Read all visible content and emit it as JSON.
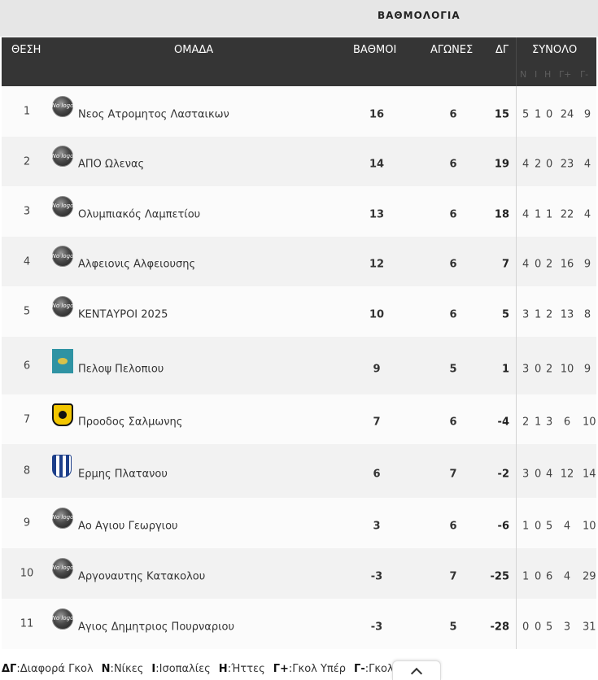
{
  "title": "ΒΑΘΜΟΛΟΓΙΑ",
  "headers": {
    "pos": "ΘΕΣΗ",
    "team": "ΟΜΑΔΑ",
    "points": "ΒΑΘΜΟΙ",
    "played": "ΑΓΩΝΕΣ",
    "gd": "ΔΓ",
    "total": "ΣΥΝΟΛΟ",
    "sub": [
      "Ν",
      "Ι",
      "Η",
      "Γ+",
      "Γ-"
    ]
  },
  "rows": [
    {
      "pos": "1",
      "team": "Νεος Ατρομητος Λασταικων",
      "logo": "no-logo-icon",
      "points": "16",
      "played": "6",
      "gd": "15",
      "w": "5",
      "d": "1",
      "l": "0",
      "gf": "24",
      "ga": "9"
    },
    {
      "pos": "2",
      "team": "ΑΠΟ Ωλενας",
      "logo": "no-logo-icon",
      "points": "14",
      "played": "6",
      "gd": "19",
      "w": "4",
      "d": "2",
      "l": "0",
      "gf": "23",
      "ga": "4"
    },
    {
      "pos": "3",
      "team": "Ολυμπιακός Λαμπετίου",
      "logo": "no-logo-icon",
      "points": "13",
      "played": "6",
      "gd": "18",
      "w": "4",
      "d": "1",
      "l": "1",
      "gf": "22",
      "ga": "4"
    },
    {
      "pos": "4",
      "team": "Αλφειονις Αλφειουσης",
      "logo": "no-logo-icon",
      "points": "12",
      "played": "6",
      "gd": "7",
      "w": "4",
      "d": "0",
      "l": "2",
      "gf": "16",
      "ga": "9"
    },
    {
      "pos": "5",
      "team": "ΚΕΝΤΑΥΡΟΙ 2025",
      "logo": "no-logo-icon",
      "points": "10",
      "played": "6",
      "gd": "5",
      "w": "3",
      "d": "1",
      "l": "2",
      "gf": "13",
      "ga": "8"
    },
    {
      "pos": "6",
      "team": "Πελοψ Πελοπιου",
      "logo": "club-crest-teal-icon",
      "points": "9",
      "played": "5",
      "gd": "1",
      "w": "3",
      "d": "0",
      "l": "2",
      "gf": "10",
      "ga": "9"
    },
    {
      "pos": "7",
      "team": "Προοδος Σαλμωνης",
      "logo": "club-crest-yellow-icon",
      "points": "7",
      "played": "6",
      "gd": "-4",
      "w": "2",
      "d": "1",
      "l": "3",
      "gf": "6",
      "ga": "10"
    },
    {
      "pos": "8",
      "team": "Ερμης Πλατανου",
      "logo": "club-crest-striped-icon",
      "points": "6",
      "played": "7",
      "gd": "-2",
      "w": "3",
      "d": "0",
      "l": "4",
      "gf": "12",
      "ga": "14"
    },
    {
      "pos": "9",
      "team": "Αο Αγιου Γεωργιου",
      "logo": "no-logo-icon",
      "points": "3",
      "played": "6",
      "gd": "-6",
      "w": "1",
      "d": "0",
      "l": "5",
      "gf": "4",
      "ga": "10"
    },
    {
      "pos": "10",
      "team": "Αργοναυτης Κατακολου",
      "logo": "no-logo-icon",
      "points": "-3",
      "played": "7",
      "gd": "-25",
      "w": "1",
      "d": "0",
      "l": "6",
      "gf": "4",
      "ga": "29"
    },
    {
      "pos": "11",
      "team": "Αγιος Δημητριος Πουρναριου",
      "logo": "no-logo-icon",
      "points": "-3",
      "played": "5",
      "gd": "-28",
      "w": "0",
      "d": "0",
      "l": "5",
      "gf": "3",
      "ga": "31"
    }
  ],
  "legend": [
    {
      "key": "ΔΓ",
      "text": "Διαφορά Γκολ"
    },
    {
      "key": "Ν",
      "text": "Νίκες"
    },
    {
      "key": "Ι",
      "text": "Ισοπαλίες"
    },
    {
      "key": "Η",
      "text": "Ήττες"
    },
    {
      "key": "Γ+",
      "text": "Γκολ Υπέρ"
    },
    {
      "key": "Γ-",
      "text": "Γκολ Κατά"
    }
  ],
  "no_logo_text": "No logo",
  "colors": {
    "header_bg": "#353535",
    "title_bg": "#e6e6e6",
    "row_odd": "#fbfbfb",
    "row_even": "#f2f2f2"
  }
}
